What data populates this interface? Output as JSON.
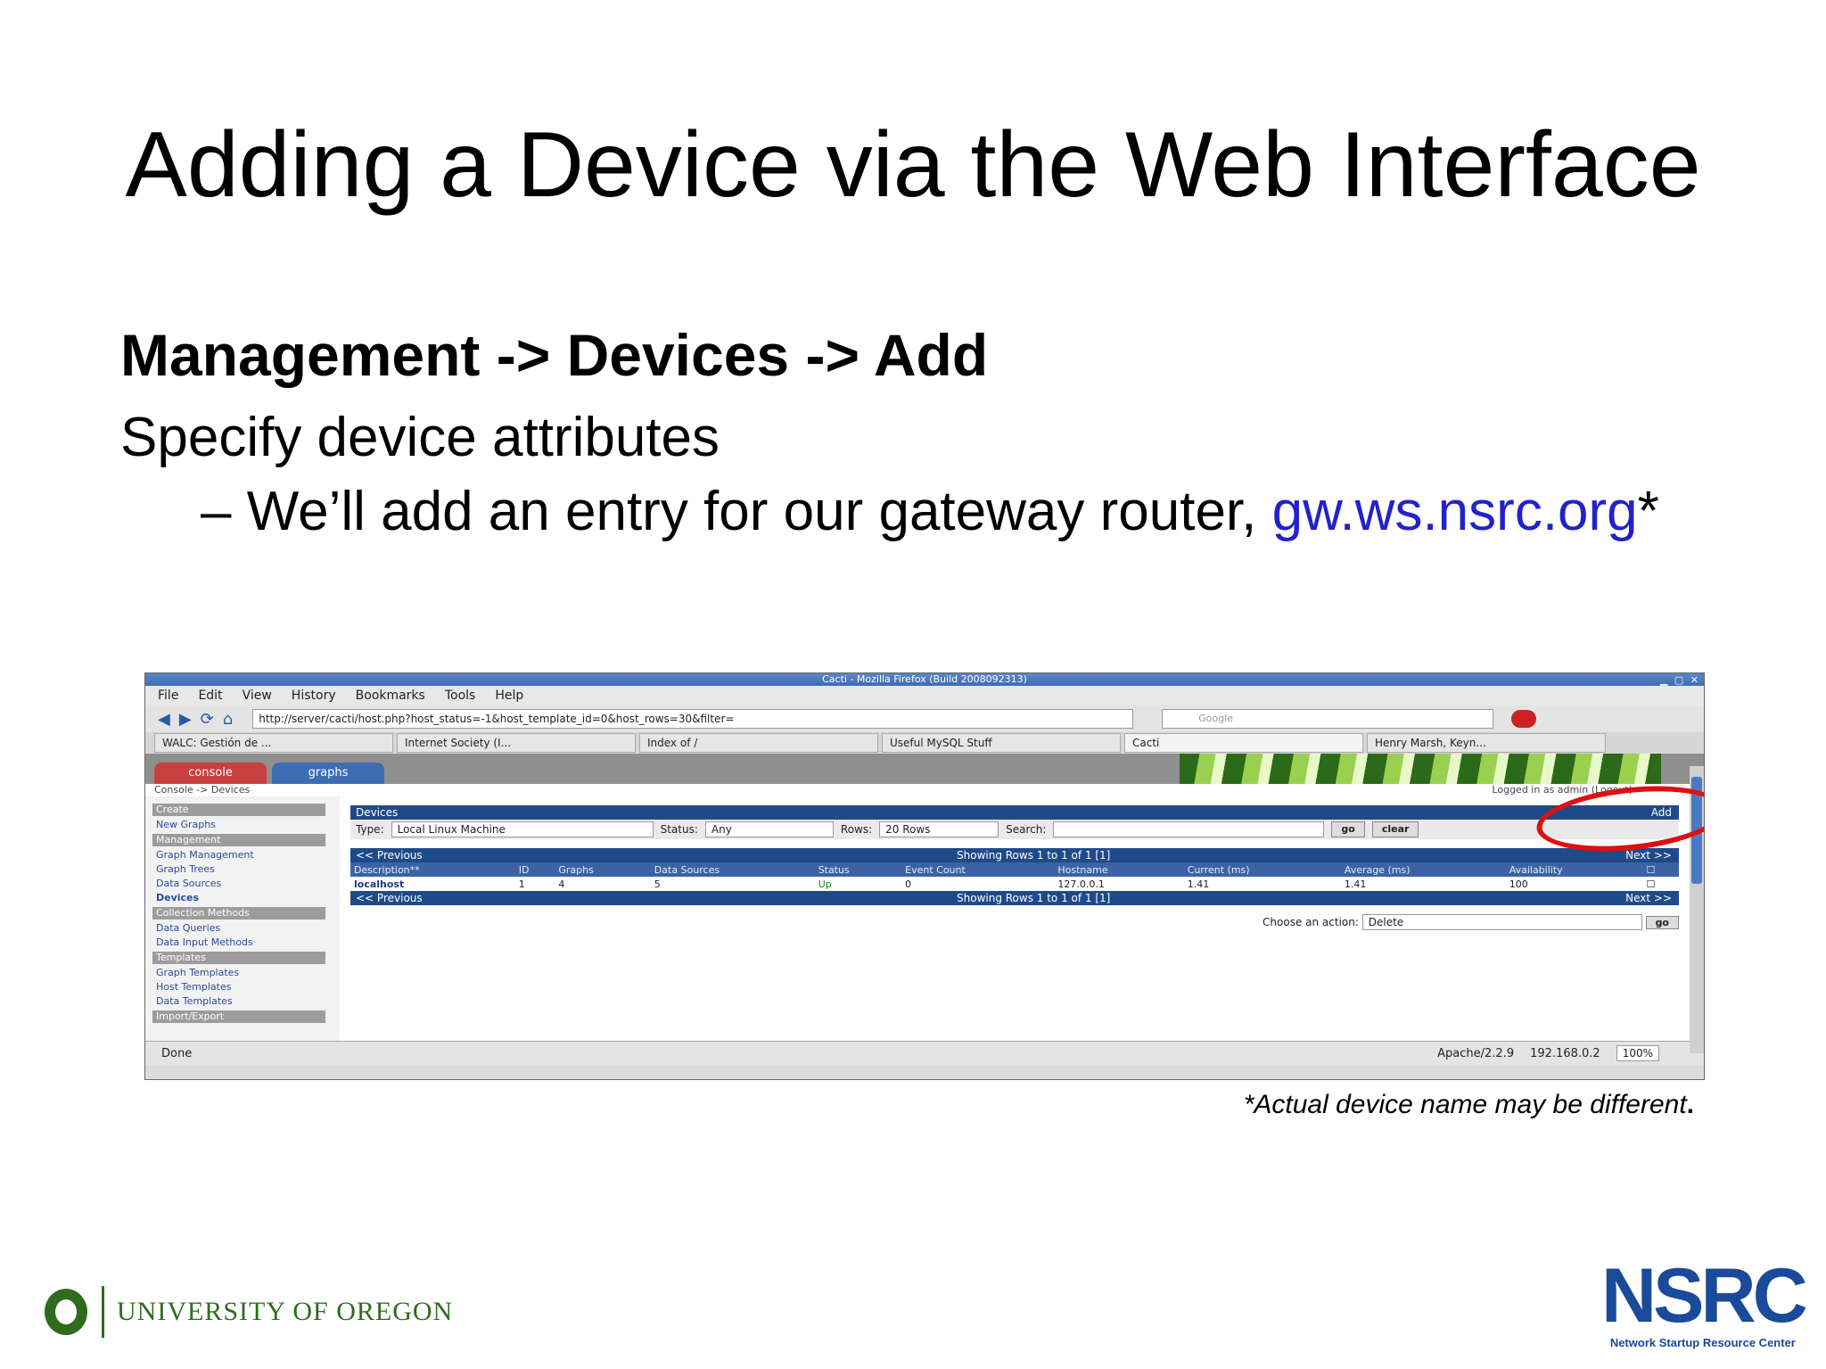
{
  "slide": {
    "title": "Adding a Device via the Web Interface",
    "heading": "Management -> Devices -> Add",
    "subheading": "Specify device attributes",
    "bullet_prefix": "– We’ll add an entry for our gateway router, ",
    "bullet_link": "gw.ws.nsrc.org",
    "bullet_suffix": "*",
    "footnote": "*Actual device name may be different",
    "footnote_period": "."
  },
  "browser": {
    "window_title": "Cacti - Mozilla Firefox (Build 2008092313)",
    "menu": [
      "File",
      "Edit",
      "View",
      "History",
      "Bookmarks",
      "Tools",
      "Help"
    ],
    "url": "http://server/cacti/host.php?host_status=-1&host_template_id=0&host_rows=30&filter=",
    "search_placeholder": "Google",
    "tabs": [
      "WALC: Gestión de ...",
      "Internet Society (I...",
      "Index of /",
      "Useful MySQL Stuff",
      "Cacti",
      "Henry Marsh, Keyn..."
    ],
    "status_left": "Done",
    "status_server": "Apache/2.2.9",
    "status_ip": "192.168.0.2",
    "zoom": "100%"
  },
  "cacti": {
    "tab_console": "console",
    "tab_graphs": "graphs",
    "breadcrumb": "Console -> Devices",
    "logged_in": "Logged in as admin (Logout)",
    "sidebar": [
      {
        "label": "Create",
        "head": true
      },
      {
        "label": "New Graphs",
        "head": false
      },
      {
        "label": "Management",
        "head": true
      },
      {
        "label": "Graph Management",
        "head": false
      },
      {
        "label": "Graph Trees",
        "head": false
      },
      {
        "label": "Data Sources",
        "head": false
      },
      {
        "label": "Devices",
        "head": false,
        "current": true
      },
      {
        "label": "Collection Methods",
        "head": true
      },
      {
        "label": "Data Queries",
        "head": false
      },
      {
        "label": "Data Input Methods",
        "head": false
      },
      {
        "label": "Templates",
        "head": true
      },
      {
        "label": "Graph Templates",
        "head": false
      },
      {
        "label": "Host Templates",
        "head": false
      },
      {
        "label": "Data Templates",
        "head": false
      },
      {
        "label": "Import/Export",
        "head": true
      }
    ],
    "devices_title": "Devices",
    "add_label": "Add",
    "filter": {
      "type_label": "Type:",
      "type_value": "Local Linux Machine",
      "status_label": "Status:",
      "status_value": "Any",
      "rows_label": "Rows:",
      "rows_value": "20 Rows",
      "search_label": "Search:",
      "go": "go",
      "clear": "clear"
    },
    "nav_previous": "<< Previous",
    "nav_showing": "Showing Rows 1 to 1 of 1 [1]",
    "nav_next": "Next >>",
    "columns": [
      "Description**",
      "ID",
      "Graphs",
      "Data Sources",
      "Status",
      "Event Count",
      "Hostname",
      "Current (ms)",
      "Average (ms)",
      "Availability"
    ],
    "rows": [
      [
        "localhost",
        "1",
        "4",
        "5",
        "Up",
        "0",
        "127.0.0.1",
        "1.41",
        "1.41",
        "100"
      ]
    ],
    "action_label": "Choose an action:",
    "action_value": "Delete",
    "action_go": "go"
  },
  "logos": {
    "uo_text": "UNIVERSITY OF OREGON",
    "nsrc_mark": "NSRC",
    "nsrc_sub": "Network Startup Resource Center"
  }
}
